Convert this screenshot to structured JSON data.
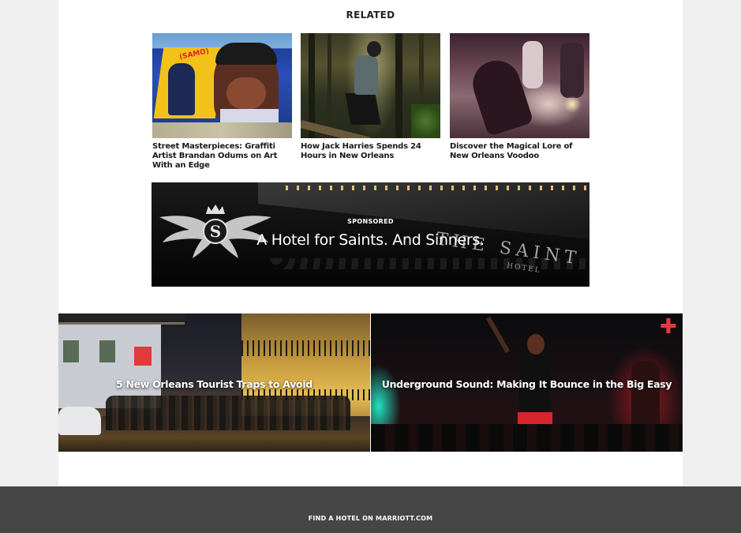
{
  "related": {
    "heading": "RELATED",
    "cards": [
      {
        "title": "Street Masterpieces: Graffiti Artist Brandan Odums on Art With an Edge",
        "image_alt": "Graffiti mural of a man's portrait"
      },
      {
        "title": "How Jack Harries Spends 24 Hours in New Orleans",
        "image_alt": "Man balancing on a log in a swamp forest"
      },
      {
        "title": "Discover the Magical Lore of New Orleans Voodoo",
        "image_alt": "Voodoo ritual gathering"
      }
    ]
  },
  "sponsored": {
    "label": "SPONSORED",
    "headline": "A Hotel for Saints. And Sinners.",
    "logo_letter": "S",
    "sign_text": "THE SAINT",
    "sign_sub": "HOTEL"
  },
  "features": [
    {
      "title": "5 New Orleans Tourist Traps to Avoid"
    },
    {
      "title": "Underground Sound: Making It Bounce in the Big Easy"
    }
  ],
  "footer": {
    "link": "FIND A HOTEL ON MARRIOTT.COM"
  }
}
